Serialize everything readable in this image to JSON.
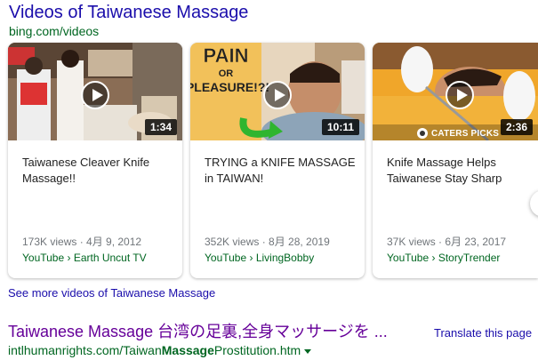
{
  "header": {
    "title": "Videos of Taiwanese Massage",
    "source": "bing.com/videos"
  },
  "cards": [
    {
      "title": "Taiwanese Cleaver Knife Massage!!",
      "duration": "1:34",
      "meta": "173K views · 4月 9, 2012",
      "source": "YouTube › Earth Uncut TV",
      "thumb_icon": "street-massage-thumbnail"
    },
    {
      "title": "TRYING a KNIFE MASSAGE in TAIWAN!",
      "duration": "10:11",
      "meta": "352K views · 8月 28, 2019",
      "source": "YouTube › LivingBobby",
      "thumb_text": [
        "PAIN",
        "OR",
        "PLEASURE!?!"
      ],
      "thumb_icon": "man-knife-massage-thumbnail"
    },
    {
      "title": "Knife Massage Helps Taiwanese Stay Sharp",
      "duration": "2:36",
      "meta": "37K views · 6月 23, 2017",
      "source": "YouTube › StoryTrender",
      "badge": "CATERS PICKS",
      "thumb_icon": "gloved-hands-knife-thumbnail"
    }
  ],
  "see_more": "See more videos of Taiwanese Massage",
  "result": {
    "title": "Taiwanese Massage 台湾の足裏,全身マッサージを ...",
    "translate": "Translate this page",
    "url_prefix": "intlhumanrights.com/Taiwan",
    "url_bold": "Massage",
    "url_suffix": "Prostitution.htm"
  },
  "colors": {
    "link": "#1a0dab",
    "visited": "#660099",
    "url_green": "#006621",
    "meta_gray": "#70757a",
    "orange": "#f5a623",
    "arrow_green": "#2fb52f"
  }
}
